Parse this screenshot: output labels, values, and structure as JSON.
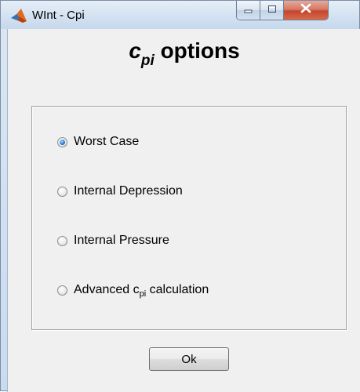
{
  "window": {
    "title": "WInt - Cpi",
    "app_icon": "matlab-logo-icon",
    "controls": {
      "minimize": "minimize-icon",
      "maximize": "maximize-icon",
      "close": "close-icon"
    }
  },
  "heading": {
    "var": "c",
    "sub": "pi",
    "rest": " options"
  },
  "options": [
    {
      "label": "Worst Case",
      "checked": true
    },
    {
      "label": "Internal Depression",
      "checked": false
    },
    {
      "label": "Internal Pressure",
      "checked": false
    },
    {
      "label_prefix": "Advanced c",
      "label_sub": "pi",
      "label_suffix": " calculation",
      "checked": false
    }
  ],
  "ok_button": {
    "label": "Ok"
  },
  "colors": {
    "title_bar": "#d5e3f2",
    "client_bg": "#f0f0f0",
    "close_button": "#c3462c"
  }
}
